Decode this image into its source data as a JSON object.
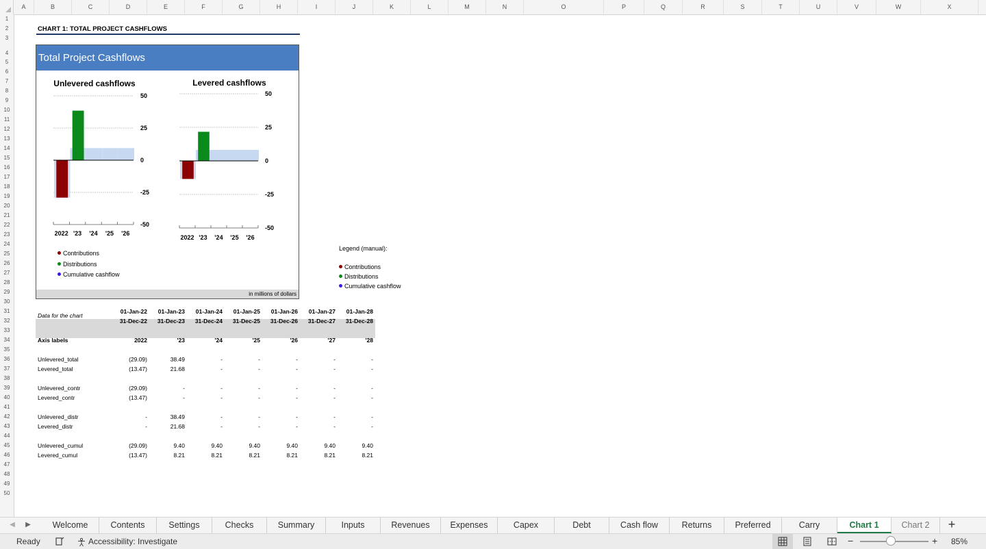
{
  "columns": [
    "A",
    "B",
    "C",
    "D",
    "E",
    "F",
    "G",
    "H",
    "I",
    "J",
    "K",
    "L",
    "M",
    "N",
    "O",
    "P",
    "Q",
    "R",
    "S",
    "T",
    "U",
    "V",
    "W",
    "X"
  ],
  "rows": [
    "1",
    "2",
    "3",
    "4",
    "5",
    "6",
    "7",
    "8",
    "9",
    "10",
    "11",
    "12",
    "13",
    "14",
    "15",
    "16",
    "17",
    "18",
    "19",
    "20",
    "21",
    "22",
    "23",
    "24",
    "25",
    "26",
    "27",
    "28",
    "29",
    "30",
    "31",
    "32",
    "33",
    "34",
    "35",
    "36",
    "37",
    "38",
    "39",
    "40",
    "41",
    "42",
    "43",
    "44",
    "45",
    "46",
    "47",
    "48",
    "49",
    "50"
  ],
  "sheet_title": "CHART 1: TOTAL PROJECT CASHFLOWS",
  "chart": {
    "header": "Total Project Cashflows",
    "footer": "in millions of dollars",
    "legend": [
      "Contributions",
      "Distributions",
      "Cumulative cashflow"
    ]
  },
  "chart_data": [
    {
      "type": "bar",
      "title": "Unlevered cashflows",
      "categories": [
        "2022",
        "'23",
        "'24",
        "'25",
        "'26"
      ],
      "y_ticks": [
        "50",
        "25",
        "0",
        "-25",
        "-50"
      ],
      "ylim": [
        -50,
        50
      ],
      "grid": true,
      "series": [
        {
          "name": "Contributions",
          "color": "#8b0000",
          "values": [
            -29.09,
            0,
            0,
            0,
            0
          ]
        },
        {
          "name": "Distributions",
          "color": "#0a8a1a",
          "values": [
            0,
            38.49,
            0,
            0,
            0
          ]
        },
        {
          "name": "Cumulative cashflow",
          "color": "#c6d9f1",
          "values": [
            -29.09,
            9.4,
            9.4,
            9.4,
            9.4
          ]
        }
      ]
    },
    {
      "type": "bar",
      "title": "Levered cashflows",
      "categories": [
        "2022",
        "'23",
        "'24",
        "'25",
        "'26"
      ],
      "y_ticks": [
        "50",
        "25",
        "0",
        "-25",
        "-50"
      ],
      "ylim": [
        -50,
        50
      ],
      "grid": true,
      "series": [
        {
          "name": "Contributions",
          "color": "#8b0000",
          "values": [
            -13.47,
            0,
            0,
            0,
            0
          ]
        },
        {
          "name": "Distributions",
          "color": "#0a8a1a",
          "values": [
            0,
            21.68,
            0,
            0,
            0
          ]
        },
        {
          "name": "Cumulative cashflow",
          "color": "#c6d9f1",
          "values": [
            -13.47,
            8.21,
            8.21,
            8.21,
            8.21
          ]
        }
      ]
    }
  ],
  "manual_legend": {
    "title": "Legend (manual):",
    "items": [
      "Contributions",
      "Distributions",
      "Cumulative cashflow"
    ]
  },
  "colors": {
    "contributions": "#8b0000",
    "distributions": "#0a8a1a",
    "cumulative": "#3b17e8"
  },
  "data_table": {
    "caption": "Data for the chart",
    "start_dates": [
      "01-Jan-22",
      "01-Jan-23",
      "01-Jan-24",
      "01-Jan-25",
      "01-Jan-26",
      "01-Jan-27",
      "01-Jan-28"
    ],
    "end_dates": [
      "31-Dec-22",
      "31-Dec-23",
      "31-Dec-24",
      "31-Dec-25",
      "31-Dec-26",
      "31-Dec-27",
      "31-Dec-28"
    ],
    "axis_label_title": "Axis labels",
    "axis_labels": [
      "2022",
      "'23",
      "'24",
      "'25",
      "'26",
      "'27",
      "'28"
    ],
    "rows": [
      {
        "label": "Unlevered_total",
        "values": [
          "(29.09)",
          "38.49",
          "-",
          "-",
          "-",
          "-",
          "-"
        ]
      },
      {
        "label": "Levered_total",
        "values": [
          "(13.47)",
          "21.68",
          "-",
          "-",
          "-",
          "-",
          "-"
        ]
      },
      {
        "label": "Unlevered_contr",
        "values": [
          "(29.09)",
          "-",
          "-",
          "-",
          "-",
          "-",
          "-"
        ]
      },
      {
        "label": "Levered_contr",
        "values": [
          "(13.47)",
          "-",
          "-",
          "-",
          "-",
          "-",
          "-"
        ]
      },
      {
        "label": "Unlevered_distr",
        "values": [
          "-",
          "38.49",
          "-",
          "-",
          "-",
          "-",
          "-"
        ]
      },
      {
        "label": "Levered_distr",
        "values": [
          "-",
          "21.68",
          "-",
          "-",
          "-",
          "-",
          "-"
        ]
      },
      {
        "label": "Unlevered_cumul",
        "values": [
          "(29.09)",
          "9.40",
          "9.40",
          "9.40",
          "9.40",
          "9.40",
          "9.40"
        ]
      },
      {
        "label": "Levered_cumul",
        "values": [
          "(13.47)",
          "8.21",
          "8.21",
          "8.21",
          "8.21",
          "8.21",
          "8.21"
        ]
      }
    ]
  },
  "tabs": [
    "Welcome",
    "Contents",
    "Settings",
    "Checks",
    "Summary",
    "Inputs",
    "Revenues",
    "Expenses",
    "Capex",
    "Debt",
    "Cash flow",
    "Returns",
    "Preferred",
    "Carry",
    "Chart 1",
    "Chart 2"
  ],
  "active_tab": "Chart 1",
  "status": {
    "ready": "Ready",
    "accessibility": "Accessibility: Investigate",
    "zoom": "85%",
    "zoom_fraction": 0.45
  }
}
